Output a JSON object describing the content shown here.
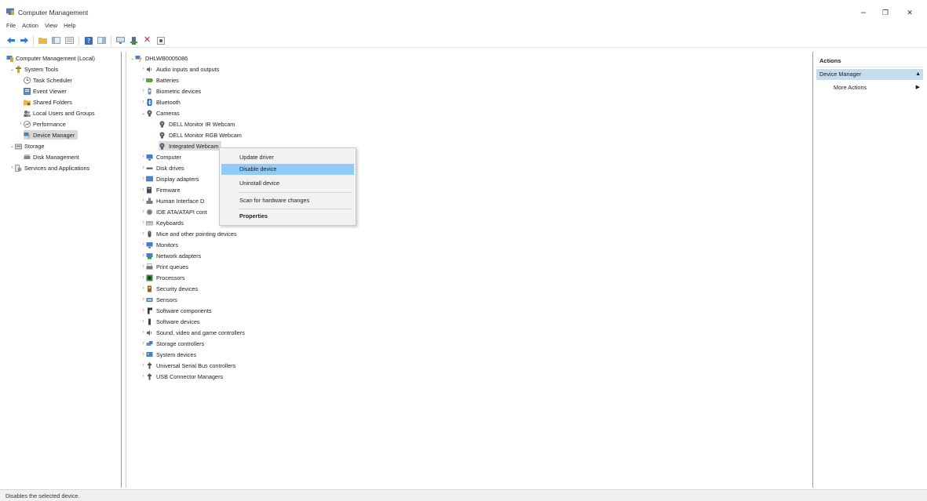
{
  "window": {
    "title": "Computer Management",
    "minimize_glyph": "–",
    "maximize_glyph": "❐",
    "close_glyph": "✕"
  },
  "menu": [
    "File",
    "Action",
    "View",
    "Help"
  ],
  "toolbar": {
    "icons": [
      "back-arrow-icon",
      "forward-arrow-icon",
      "up-folder-icon",
      "console-tree-icon",
      "export-list-icon",
      "help-icon",
      "properties-icon",
      "show-hide-icon",
      "update-driver-icon",
      "uninstall-icon",
      "scan-hardware-icon"
    ]
  },
  "tree": {
    "root": "Computer Management (Local)",
    "system_tools": "System Tools",
    "task_scheduler": "Task Scheduler",
    "event_viewer": "Event Viewer",
    "shared_folders": "Shared Folders",
    "local_users": "Local Users and Groups",
    "performance": "Performance",
    "device_manager": "Device Manager",
    "storage": "Storage",
    "disk_management": "Disk Management",
    "services": "Services and Applications"
  },
  "devices": {
    "computer_name": "DHLWB0005086",
    "audio": "Audio inputs and outputs",
    "batteries": "Batteries",
    "biometric": "Biometric devices",
    "bluetooth": "Bluetooth",
    "cameras": "Cameras",
    "camera_ir": "DELL Monitor IR Webcam",
    "camera_rgb": "DELL Monitor RGB Webcam",
    "camera_integrated": "Integrated Webcam",
    "computer": "Computer",
    "disk_drives": "Disk drives",
    "display": "Display adapters",
    "firmware": "Firmware",
    "hid": "Human Interface D",
    "ide": "IDE ATA/ATAPI cont",
    "keyboards": "Keyboards",
    "mice": "Mice and other pointing devices",
    "monitors": "Monitors",
    "network": "Network adapters",
    "print_queues": "Print queues",
    "processors": "Processors",
    "security": "Security devices",
    "sensors": "Sensors",
    "software_components": "Software components",
    "software_devices": "Software devices",
    "sound": "Sound, video and game controllers",
    "storage_controllers": "Storage controllers",
    "system_devices": "System devices",
    "usb": "Universal Serial Bus controllers",
    "usb_connector": "USB Connector Managers"
  },
  "context_menu": {
    "update_driver": "Update driver",
    "disable_device": "Disable device",
    "uninstall_device": "Uninstall device",
    "scan": "Scan for hardware changes",
    "properties": "Properties"
  },
  "actions": {
    "header": "Actions",
    "section": "Device Manager",
    "more": "More Actions"
  },
  "status": {
    "text": "Disables the selected device."
  },
  "colors": {
    "selection_blue": "#91c9f7",
    "actions_section_bg": "#c5dcef"
  }
}
